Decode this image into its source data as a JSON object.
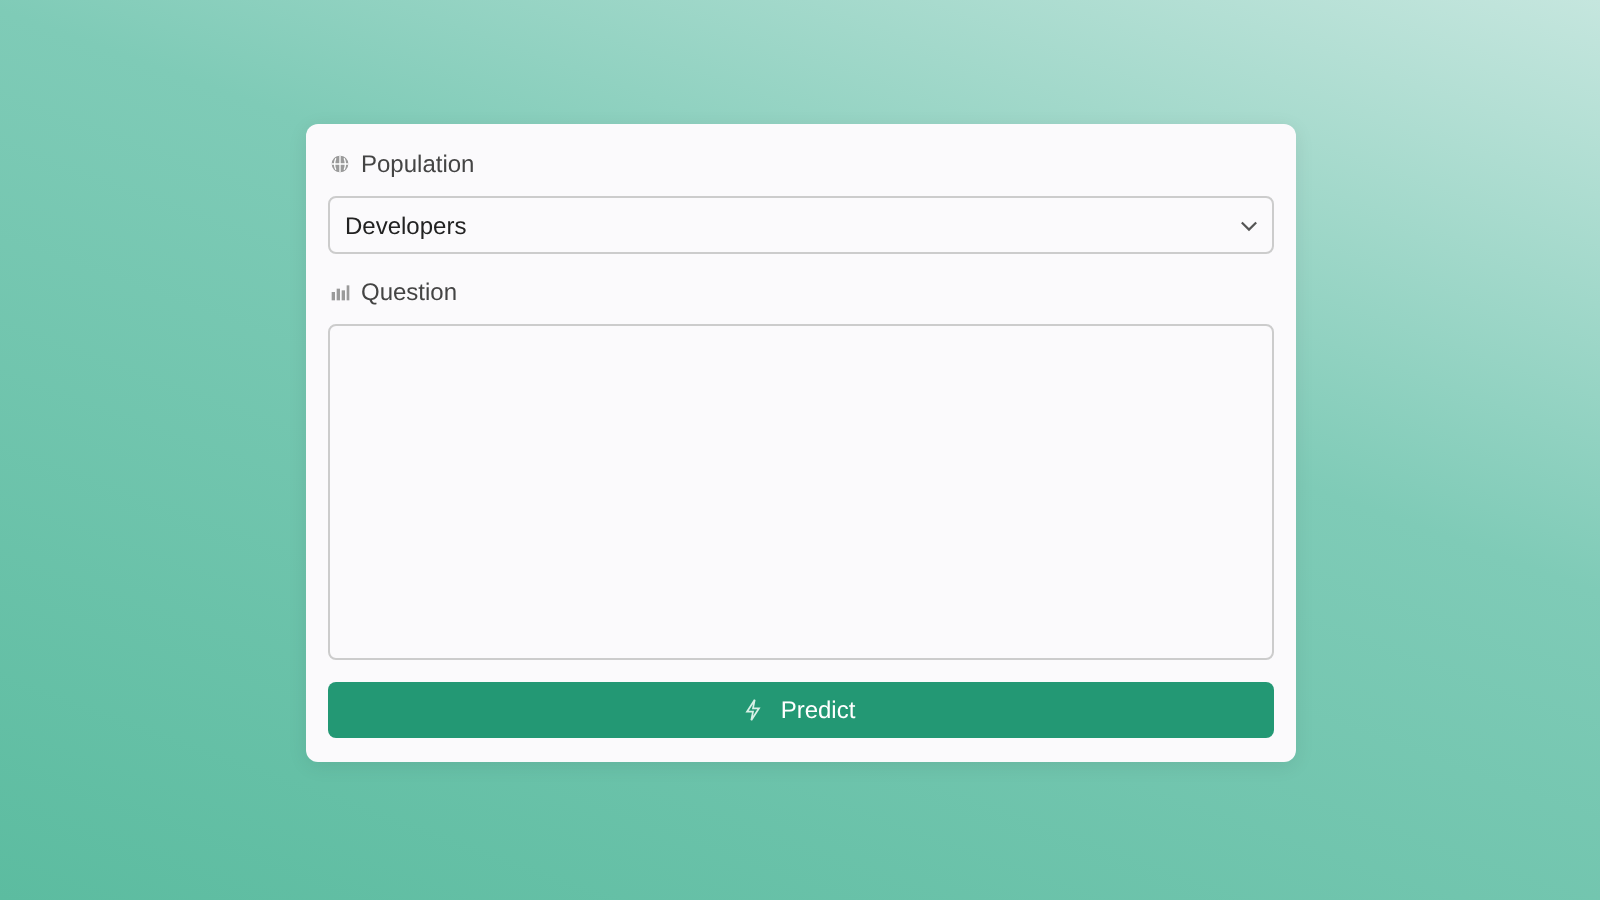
{
  "form": {
    "population_label": "Population",
    "population_select": {
      "value": "Developers"
    },
    "question_label": "Question",
    "submit_button": "Predict"
  }
}
